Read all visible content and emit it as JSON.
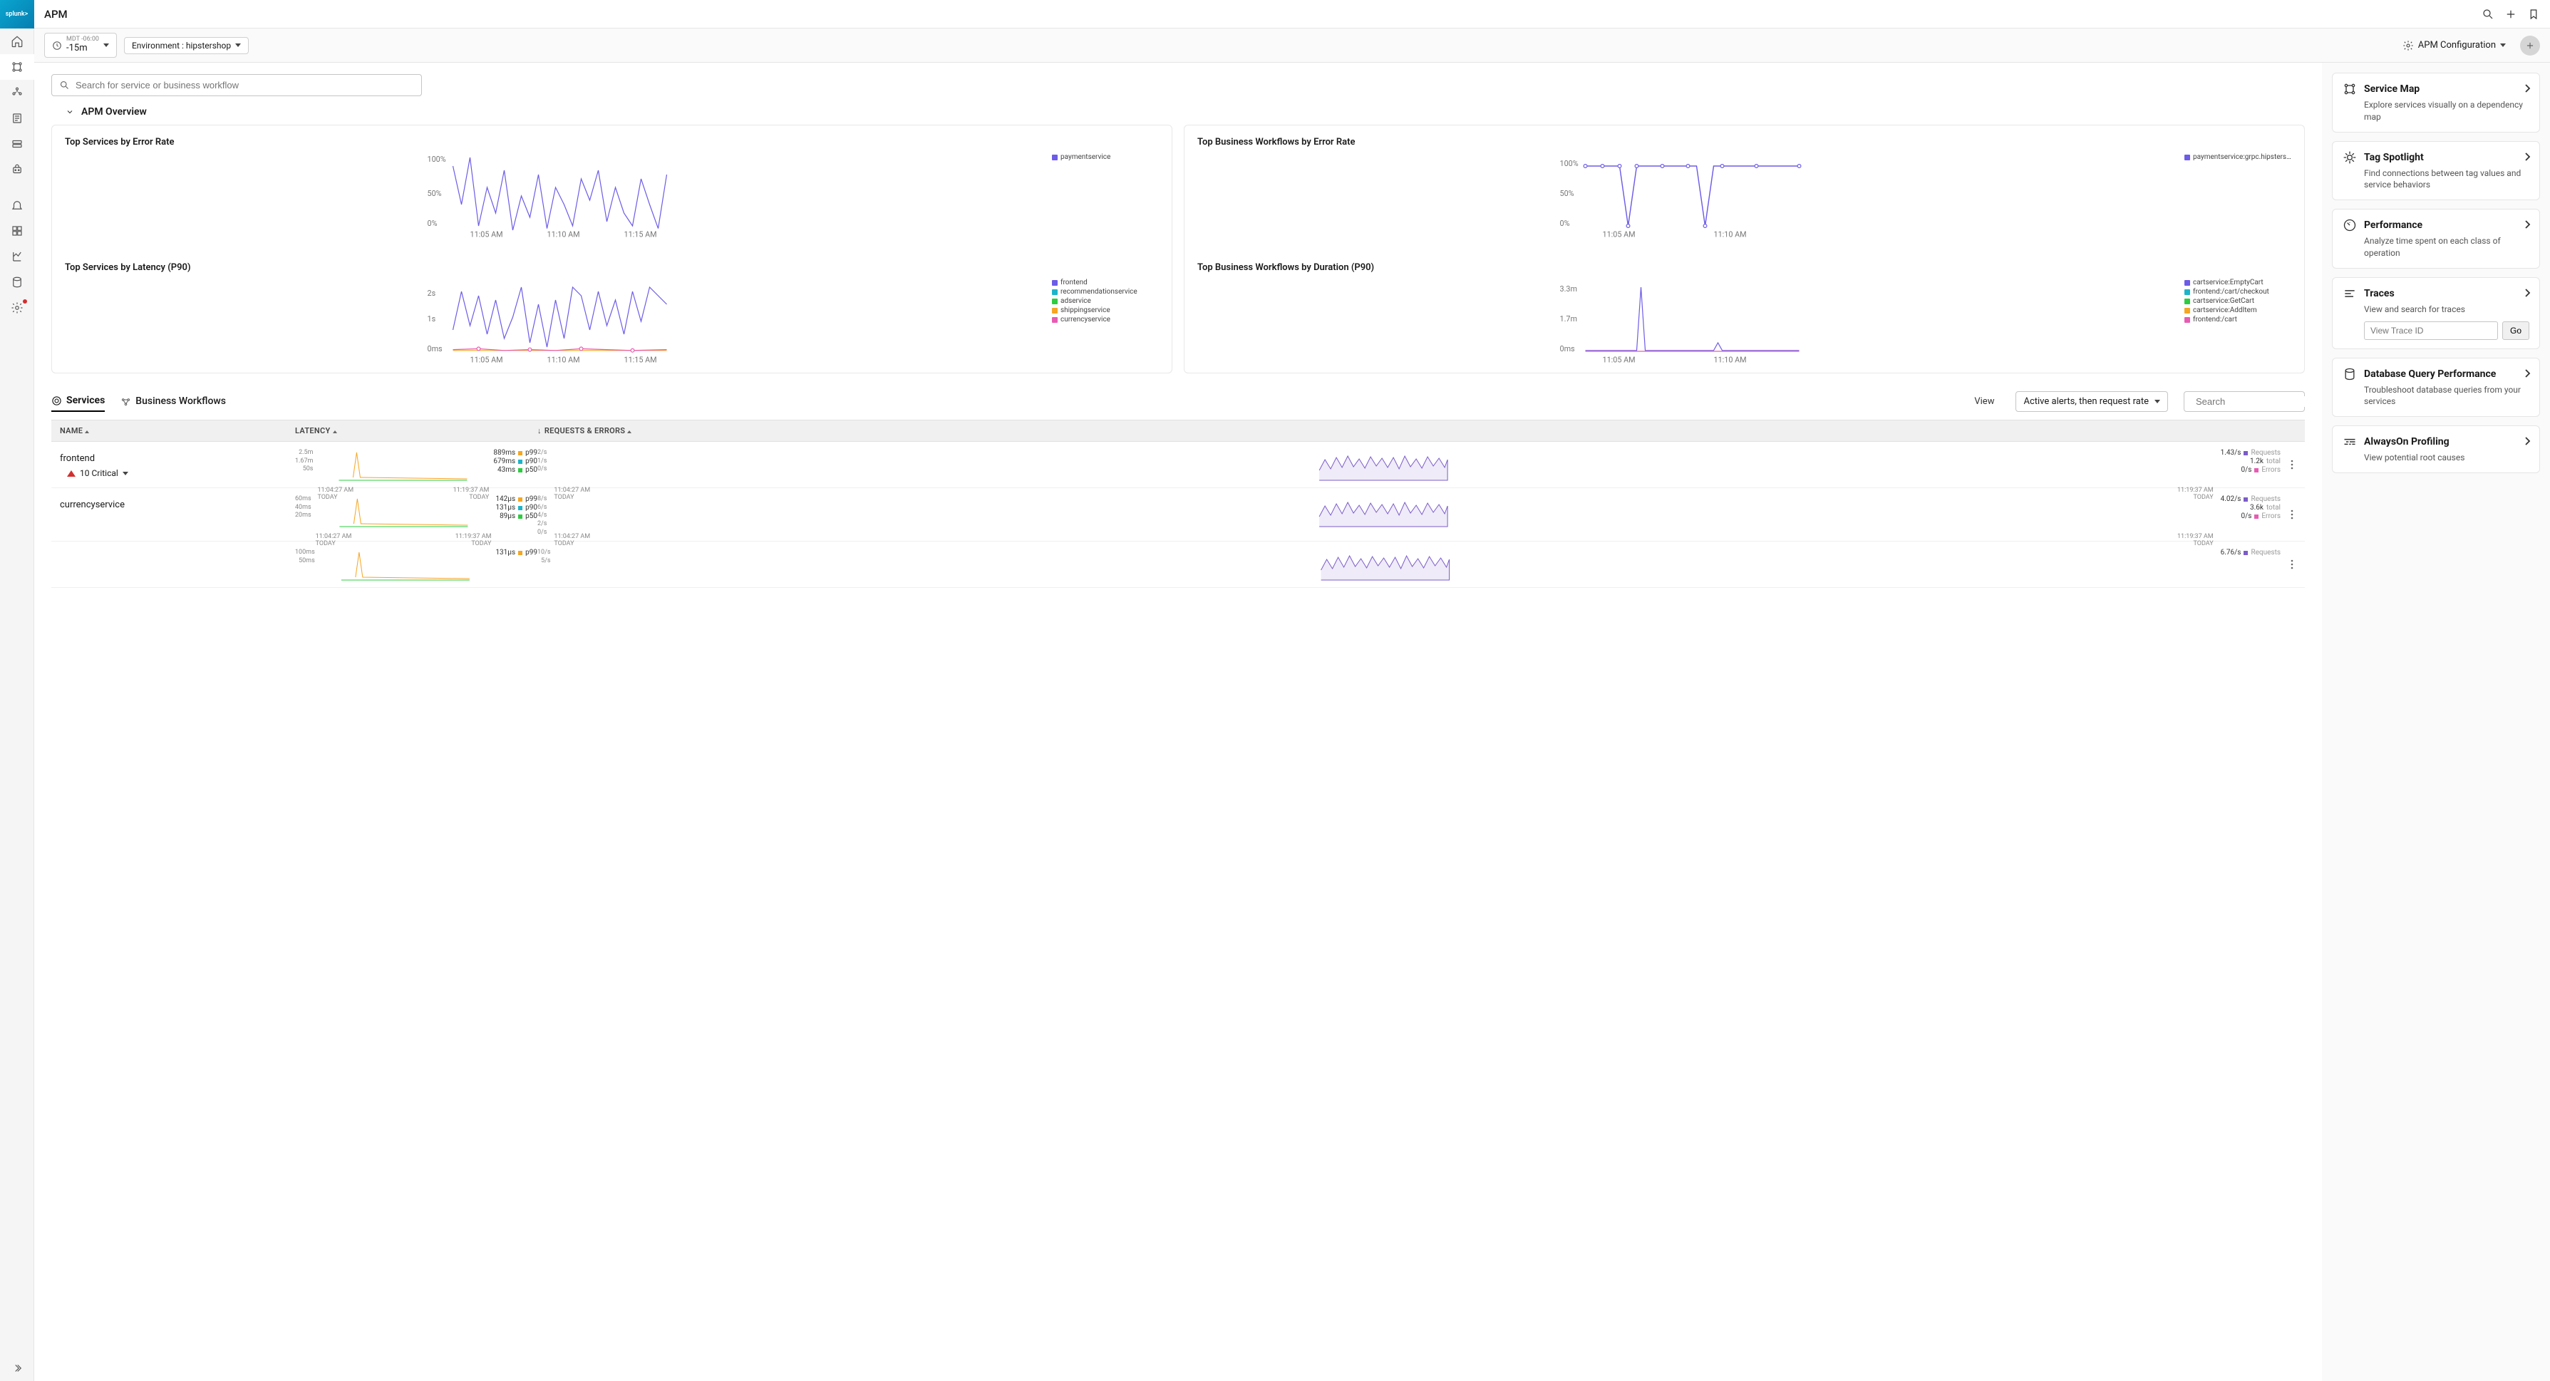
{
  "header": {
    "title": "APM"
  },
  "filter": {
    "tz": "MDT -06:00",
    "range": "-15m",
    "env_label": "Environment : hipstershop",
    "config_label": "APM Configuration"
  },
  "search": {
    "placeholder": "Search for service or business workflow"
  },
  "overview_label": "APM Overview",
  "charts": {
    "services_error": {
      "title": "Top Services by Error Rate",
      "legend": [
        "paymentservice"
      ],
      "ylabels": [
        "100%",
        "50%",
        "0%"
      ],
      "xlabels": [
        "11:05 AM",
        "11:10 AM",
        "11:15 AM"
      ]
    },
    "workflows_error": {
      "title": "Top Business Workflows by Error Rate",
      "legend": [
        "paymentservice:grpc.hipsters…"
      ],
      "ylabels": [
        "100%",
        "50%",
        "0%"
      ],
      "xlabels": [
        "11:05 AM",
        "11:10 AM"
      ]
    },
    "services_latency": {
      "title": "Top Services by Latency (P90)",
      "legend": [
        "frontend",
        "recommendationservice",
        "adservice",
        "shippingservice",
        "currencyservice"
      ],
      "ylabels": [
        "2s",
        "1s",
        "0ms"
      ],
      "xlabels": [
        "11:05 AM",
        "11:10 AM",
        "11:15 AM"
      ]
    },
    "workflows_duration": {
      "title": "Top Business Workflows by Duration (P90)",
      "legend": [
        "cartservice:EmptyCart",
        "frontend:/cart/checkout",
        "cartservice:GetCart",
        "cartservice:AddItem",
        "frontend:/cart"
      ],
      "ylabels": [
        "3.3m",
        "1.7m",
        "0ms"
      ],
      "xlabels": [
        "11:05 AM",
        "11:10 AM"
      ]
    }
  },
  "chart_data": [
    {
      "type": "line",
      "title": "Top Services by Error Rate",
      "ylabel": "%",
      "ylim": [
        0,
        100
      ],
      "x": [
        "11:03",
        "11:04",
        "11:05",
        "11:06",
        "11:07",
        "11:08",
        "11:09",
        "11:10",
        "11:11",
        "11:12",
        "11:13",
        "11:14",
        "11:15",
        "11:16",
        "11:17",
        "11:18"
      ],
      "series": [
        {
          "name": "paymentservice",
          "values": [
            90,
            40,
            100,
            10,
            60,
            30,
            80,
            5,
            50,
            20,
            70,
            0,
            60,
            40,
            5,
            70
          ]
        }
      ]
    },
    {
      "type": "line",
      "title": "Top Business Workflows by Error Rate",
      "ylabel": "%",
      "ylim": [
        0,
        100
      ],
      "x": [
        "11:03",
        "11:04",
        "11:05",
        "11:06",
        "11:07",
        "11:08",
        "11:09",
        "11:10",
        "11:11",
        "11:12",
        "11:13",
        "11:14"
      ],
      "series": [
        {
          "name": "paymentservice:grpc.hipstershop",
          "values": [
            100,
            100,
            100,
            0,
            100,
            100,
            100,
            100,
            0,
            100,
            100,
            100
          ]
        }
      ]
    },
    {
      "type": "line",
      "title": "Top Services by Latency (P90)",
      "ylabel": "s",
      "ylim": [
        0,
        2.5
      ],
      "x": [
        "11:03",
        "11:04",
        "11:05",
        "11:06",
        "11:07",
        "11:08",
        "11:09",
        "11:10",
        "11:11",
        "11:12",
        "11:13",
        "11:14",
        "11:15",
        "11:16",
        "11:17",
        "11:18"
      ],
      "series": [
        {
          "name": "frontend",
          "values": [
            0.6,
            2.2,
            0.8,
            1.8,
            0.5,
            1.6,
            0.4,
            0.9,
            2.0,
            0.3,
            1.4,
            0.2,
            1.7,
            0.4,
            2.3,
            1.9
          ]
        },
        {
          "name": "recommendationservice",
          "values": [
            0.1,
            0.1,
            0.1,
            0.1,
            0.1,
            0.1,
            0.1,
            0.1,
            0.1,
            0.1,
            0.1,
            0.1,
            0.1,
            0.1,
            0.1,
            0.1
          ]
        },
        {
          "name": "adservice",
          "values": [
            0.08,
            0.08,
            0.08,
            0.08,
            0.08,
            0.08,
            0.08,
            0.08,
            0.08,
            0.08,
            0.08,
            0.08,
            0.08,
            0.08,
            0.08,
            0.08
          ]
        },
        {
          "name": "shippingservice",
          "values": [
            0.05,
            0.05,
            0.05,
            0.05,
            0.05,
            0.05,
            0.05,
            0.05,
            0.05,
            0.05,
            0.05,
            0.05,
            0.05,
            0.05,
            0.05,
            0.05
          ]
        },
        {
          "name": "currencyservice",
          "values": [
            0.04,
            0.04,
            0.04,
            0.04,
            0.04,
            0.04,
            0.04,
            0.04,
            0.04,
            0.04,
            0.04,
            0.04,
            0.04,
            0.04,
            0.04,
            0.04
          ]
        }
      ]
    },
    {
      "type": "line",
      "title": "Top Business Workflows by Duration (P90)",
      "ylabel": "m",
      "ylim": [
        0,
        3.3
      ],
      "x": [
        "11:03",
        "11:04",
        "11:05",
        "11:06",
        "11:07",
        "11:08",
        "11:09",
        "11:10",
        "11:11",
        "11:12",
        "11:13",
        "11:14"
      ],
      "series": [
        {
          "name": "cartservice:EmptyCart",
          "values": [
            0.02,
            0.02,
            0.02,
            3.2,
            0.02,
            0.02,
            0.02,
            0.02,
            0.2,
            0.02,
            0.02,
            0.02
          ]
        },
        {
          "name": "frontend:/cart/checkout",
          "values": [
            0.01,
            0.01,
            0.01,
            0.01,
            0.01,
            0.01,
            0.01,
            0.01,
            0.01,
            0.01,
            0.01,
            0.01
          ]
        },
        {
          "name": "cartservice:GetCart",
          "values": [
            0.01,
            0.01,
            0.01,
            0.01,
            0.01,
            0.01,
            0.01,
            0.01,
            0.01,
            0.01,
            0.01,
            0.01
          ]
        },
        {
          "name": "cartservice:AddItem",
          "values": [
            0.01,
            0.01,
            0.01,
            0.01,
            0.01,
            0.01,
            0.01,
            0.01,
            0.01,
            0.01,
            0.01,
            0.01
          ]
        },
        {
          "name": "frontend:/cart",
          "values": [
            0.01,
            0.01,
            0.01,
            0.01,
            0.01,
            0.01,
            0.01,
            0.01,
            0.01,
            0.01,
            0.01,
            0.01
          ]
        }
      ]
    }
  ],
  "tabs": {
    "services": "Services",
    "workflows": "Business Workflows"
  },
  "view": {
    "label": "View",
    "value": "Active alerts, then request rate",
    "search_ph": "Search"
  },
  "table": {
    "cols": {
      "name": "NAME",
      "latency": "LATENCY",
      "req": "REQUESTS & ERRORS"
    },
    "rows": [
      {
        "name": "frontend",
        "alerts": "10 Critical",
        "lat_y": [
          "2.5m",
          "1.67m",
          "50s"
        ],
        "t1": "11:04:27 AM",
        "t2": "11:19:37 AM",
        "today": "TODAY",
        "lat_stats": [
          {
            "v": "889ms",
            "p": "p99",
            "c": "#f5a623"
          },
          {
            "v": "679ms",
            "p": "p90",
            "c": "#1db4c9"
          },
          {
            "v": "43ms",
            "p": "p50",
            "c": "#2ecc40"
          }
        ],
        "req_y": [
          "2/s",
          "1/s",
          "0/s"
        ],
        "req_stats": [
          {
            "v": "1.43/s",
            "l": "Requests",
            "c": "#7b5cc9"
          },
          {
            "v": "1.2k",
            "l": "total",
            "c": null
          },
          {
            "v": "0/s",
            "l": "Errors",
            "c": "#e85bb3"
          }
        ]
      },
      {
        "name": "currencyservice",
        "alerts": null,
        "lat_y": [
          "60ms",
          "40ms",
          "20ms"
        ],
        "t1": "11:04:27 AM",
        "t2": "11:19:37 AM",
        "today": "TODAY",
        "lat_stats": [
          {
            "v": "142µs",
            "p": "p99",
            "c": "#f5a623"
          },
          {
            "v": "131µs",
            "p": "p90",
            "c": "#1db4c9"
          },
          {
            "v": "89µs",
            "p": "p50",
            "c": "#2ecc40"
          }
        ],
        "req_y": [
          "8/s",
          "6/s",
          "4/s",
          "2/s",
          "0/s"
        ],
        "req_stats": [
          {
            "v": "4.02/s",
            "l": "Requests",
            "c": "#7b5cc9"
          },
          {
            "v": "3.6k",
            "l": "total",
            "c": null
          },
          {
            "v": "0/s",
            "l": "Errors",
            "c": "#e85bb3"
          }
        ]
      },
      {
        "name": "",
        "alerts": null,
        "lat_y": [
          "100ms",
          "50ms"
        ],
        "t1": "",
        "t2": "",
        "today": "",
        "lat_stats": [
          {
            "v": "131µs",
            "p": "p99",
            "c": "#f5a623"
          }
        ],
        "req_y": [
          "10/s",
          "5/s"
        ],
        "req_stats": [
          {
            "v": "6.76/s",
            "l": "Requests",
            "c": "#7b5cc9"
          }
        ]
      }
    ]
  },
  "right": {
    "cards": [
      {
        "title": "Service Map",
        "desc": "Explore services visually on a dependency map",
        "icon": "servicemap"
      },
      {
        "title": "Tag Spotlight",
        "desc": "Find connections between tag values and service behaviors",
        "icon": "spotlight"
      },
      {
        "title": "Performance",
        "desc": "Analyze time spent on each class of operation",
        "icon": "gauge"
      },
      {
        "title": "Traces",
        "desc": "View and search for traces",
        "icon": "traces",
        "trace": true,
        "placeholder": "View Trace ID",
        "go": "Go"
      },
      {
        "title": "Database Query Performance",
        "desc": "Troubleshoot database queries from your services",
        "icon": "db"
      },
      {
        "title": "AlwaysOn Profiling",
        "desc": "View potential root causes",
        "icon": "profiling"
      }
    ]
  },
  "colors": {
    "legend": [
      "#6c5ce7",
      "#1db4c9",
      "#2ecc40",
      "#f5a623",
      "#e85bb3"
    ]
  }
}
